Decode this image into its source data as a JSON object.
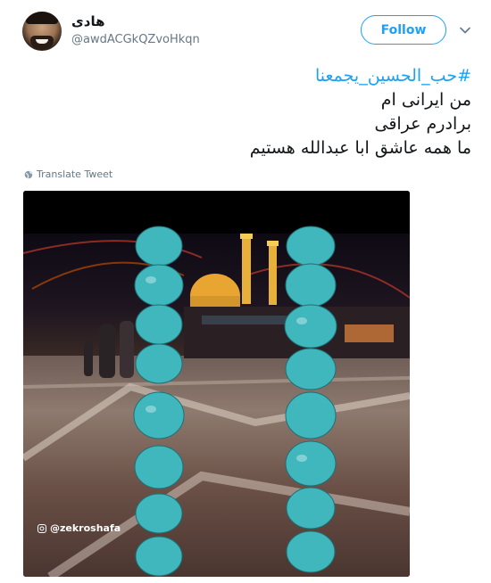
{
  "user": {
    "display_name": "هادی",
    "handle": "@awdACGkQZvoHkqn"
  },
  "follow_label": "Follow",
  "tweet": {
    "hashtag": "#حب_الحسين_يجمعنا",
    "lines": [
      "من ایرانی ام",
      "برادرم عراقی",
      "ما همه عاشق ابا عبدالله هستیم"
    ]
  },
  "translate_label": "Translate Tweet",
  "media": {
    "watermark": "@zekroshafa"
  },
  "colors": {
    "accent": "#1da1f2",
    "text": "#14171a",
    "secondary": "#657786"
  }
}
